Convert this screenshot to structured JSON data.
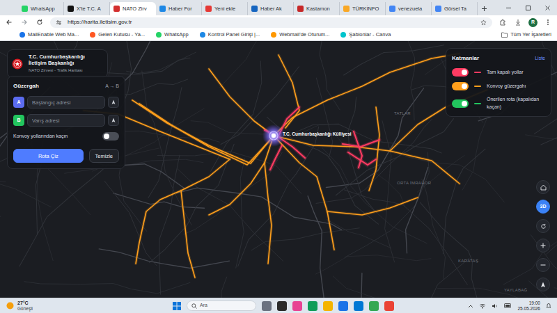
{
  "browser": {
    "tabs": [
      {
        "label": "WhatsApp",
        "selected": false
      },
      {
        "label": "X'te T.C. A",
        "selected": false
      },
      {
        "label": "NATO Zirv",
        "selected": true
      },
      {
        "label": "Haber For",
        "selected": false
      },
      {
        "label": "Yeni ekle",
        "selected": false
      },
      {
        "label": "Haber Ak",
        "selected": false
      },
      {
        "label": "Kastamon",
        "selected": false
      },
      {
        "label": "TÜRKİNFO",
        "selected": false
      },
      {
        "label": "venezuela",
        "selected": false
      },
      {
        "label": "Görsel Ta",
        "selected": false
      }
    ],
    "address": "https://harita.iletisim.gov.tr",
    "profile": "R",
    "bookmarks": [
      "MailEnable Web Ma...",
      "Gelen Kutusu - Ya...",
      "WhatsApp",
      "Kontrol Panel Girişi |...",
      "Webmail'de Oturum...",
      "Şablonlar - Canva"
    ],
    "all_bookmarks": "Tüm Yer İşaretleri"
  },
  "page": {
    "org": {
      "title": "T.C. Cumhurbaşkanlığı İletişim Başkanlığı",
      "subtitle": "NATO Zirvesi - Trafik Haritası"
    },
    "route": {
      "title": "Güzergah",
      "hint": "A → B",
      "fields": [
        {
          "badge": "A",
          "placeholder": "Başlangıç adresi",
          "color": "#5b6cf0"
        },
        {
          "badge": "B",
          "placeholder": "Varış adresi",
          "color": "#22c55e"
        }
      ],
      "avoid": {
        "label": "Konvoy yollarından kaçın",
        "on": false
      },
      "draw": "Rota Çiz",
      "clear": "Temizle"
    },
    "layers": {
      "title": "Katmanlar",
      "link": "Liste",
      "items": [
        {
          "label": "Tam kapalı yollar",
          "on": true,
          "color": "#ff3b62"
        },
        {
          "label": "Konvoy güzergahı",
          "on": true,
          "color": "#ff9f1c"
        },
        {
          "label": "Önerilen rota (kapalıdan kaçan)",
          "on": true,
          "color": "#22c55e"
        }
      ]
    },
    "map": {
      "landmark": "T.C. Cumhurbaşkanlığı Külliyesi",
      "labels": [
        "TATLAR",
        "ORTA İMRAHOR",
        "KARATAŞ",
        "YAYLABAĞ"
      ],
      "three_d": {
        "label": "3D",
        "on": true
      }
    }
  },
  "taskbar": {
    "temperature": "27°C",
    "condition": "Güneşli",
    "search": "Ara",
    "time": "19:00",
    "date": "25.05.2026"
  }
}
